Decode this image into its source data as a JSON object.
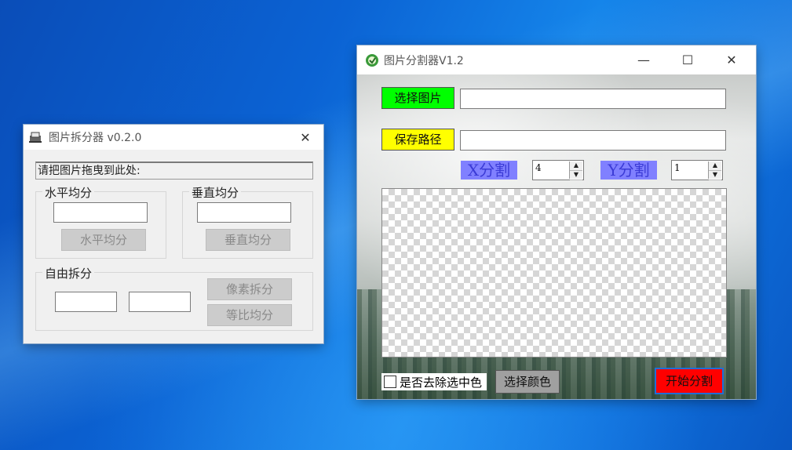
{
  "desktop": {
    "accent": "#0b63d4"
  },
  "window1": {
    "title": "图片拆分器 v0.2.0",
    "drop_hint": "请把图片拖曳到此处:",
    "horizontal_group": {
      "label": "水平均分",
      "input_value": "",
      "button": "水平均分"
    },
    "vertical_group": {
      "label": "垂直均分",
      "input_value": "",
      "button": "垂直均分"
    },
    "free_group": {
      "label": "自由拆分",
      "input1_value": "",
      "input2_value": "",
      "pixel_button": "像素拆分",
      "ratio_button": "等比均分"
    },
    "close_glyph": "✕"
  },
  "window2": {
    "title": "图片分割器V1.2",
    "select_image_button": "选择图片",
    "image_path_value": "",
    "save_path_button": "保存路径",
    "save_path_value": "",
    "x_label": "X分割",
    "x_value": "4",
    "y_label": "Y分割",
    "y_value": "1",
    "remove_color_checkbox": "是否去除选中色",
    "choose_color_button": "选择颜色",
    "start_button": "开始分割",
    "minimize_glyph": "—",
    "maximize_glyph": "☐",
    "close_glyph": "✕",
    "colors": {
      "select": "#00ff00",
      "save": "#ffff00",
      "xy": "#8080ff",
      "start": "#ff0000"
    }
  }
}
